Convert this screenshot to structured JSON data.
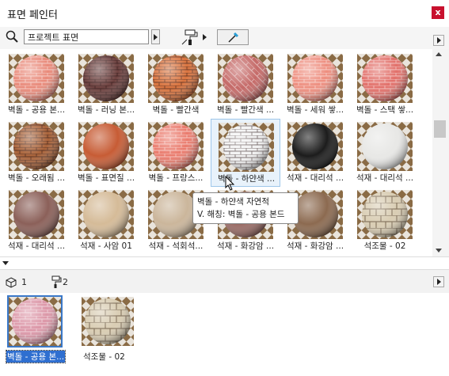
{
  "window": {
    "title": "표면 페인터",
    "close_label": "x"
  },
  "toolbar": {
    "search_value": "프로젝트 표면"
  },
  "materials": [
    {
      "label": "벽돌 - 공용 본...",
      "style": "brick-salmon"
    },
    {
      "label": "벽돌 - 러닝 본...",
      "style": "brick-dark"
    },
    {
      "label": "벽돌 - 빨간색",
      "style": "brick-orange"
    },
    {
      "label": "벽돌 - 빨간색 ...",
      "style": "brick-herring"
    },
    {
      "label": "벽돌 - 세워 쌓...",
      "style": "brick-coral"
    },
    {
      "label": "벽돌 - 스택 쌓...",
      "style": "brick-stack"
    },
    {
      "label": "벽돌 - 오래됨 ...",
      "style": "brick-old"
    },
    {
      "label": "벽돌 - 표면질 ...",
      "style": "brick-rough"
    },
    {
      "label": "벽돌 - 프랑스...",
      "style": "brick-french"
    },
    {
      "label": "벽돌 - 하얀색 ...",
      "style": "brick-white"
    },
    {
      "label": "석재 - 대리석 ...",
      "style": "marble-black"
    },
    {
      "label": "석재 - 대리석 ...",
      "style": "marble-white"
    },
    {
      "label": "석재 - 대리석 ...",
      "style": "stone-purple"
    },
    {
      "label": "석재 - 사암 01",
      "style": "sandstone"
    },
    {
      "label": "석재 - 석회석...",
      "style": "limestone"
    },
    {
      "label": "석재 - 화강암 ...",
      "style": "granite-red"
    },
    {
      "label": "석재 - 화강암 ...",
      "style": "granite-brown"
    },
    {
      "label": "석조물 - 02",
      "style": "masonry"
    }
  ],
  "tooltip": {
    "line1": "벽돌 - 하얀색 자연적",
    "line2": "V. 해칭: 벽돌 - 공용 본드"
  },
  "selection_bar": {
    "count_surfaces": "1",
    "count_painted": "2"
  },
  "selected_items": [
    {
      "label": "벽돌 - 공용 본...",
      "style": "brick-salmon-sel"
    },
    {
      "label": "석조물 - 02",
      "style": "masonry"
    }
  ]
}
